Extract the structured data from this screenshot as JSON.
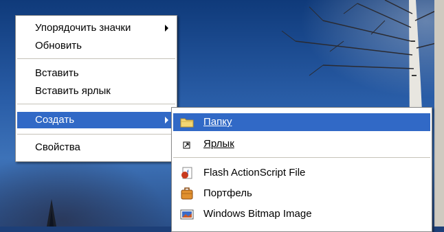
{
  "main_menu": {
    "items": [
      {
        "label": "Упорядочить значки",
        "has_submenu": true
      },
      {
        "label": "Обновить"
      },
      {
        "label": "Вставить"
      },
      {
        "label": "Вставить ярлык"
      },
      {
        "label": "Создать",
        "has_submenu": true,
        "highlighted": true
      },
      {
        "label": "Свойства"
      }
    ]
  },
  "create_submenu": {
    "items": [
      {
        "label": "Папку",
        "icon": "folder-icon",
        "highlighted": true,
        "mnemonic": "П"
      },
      {
        "label": "Ярлык",
        "icon": "shortcut-icon",
        "mnemonic": "Я"
      },
      {
        "label": "Flash ActionScript File",
        "icon": "flash-actionscript-file-icon"
      },
      {
        "label": "Портфель",
        "icon": "briefcase-icon"
      },
      {
        "label": "Windows Bitmap Image",
        "icon": "bitmap-image-icon"
      }
    ]
  },
  "colors": {
    "highlight": "#3169c6",
    "menu_bg": "#ffffff",
    "wallpaper_sky": "#2a5ea8"
  }
}
